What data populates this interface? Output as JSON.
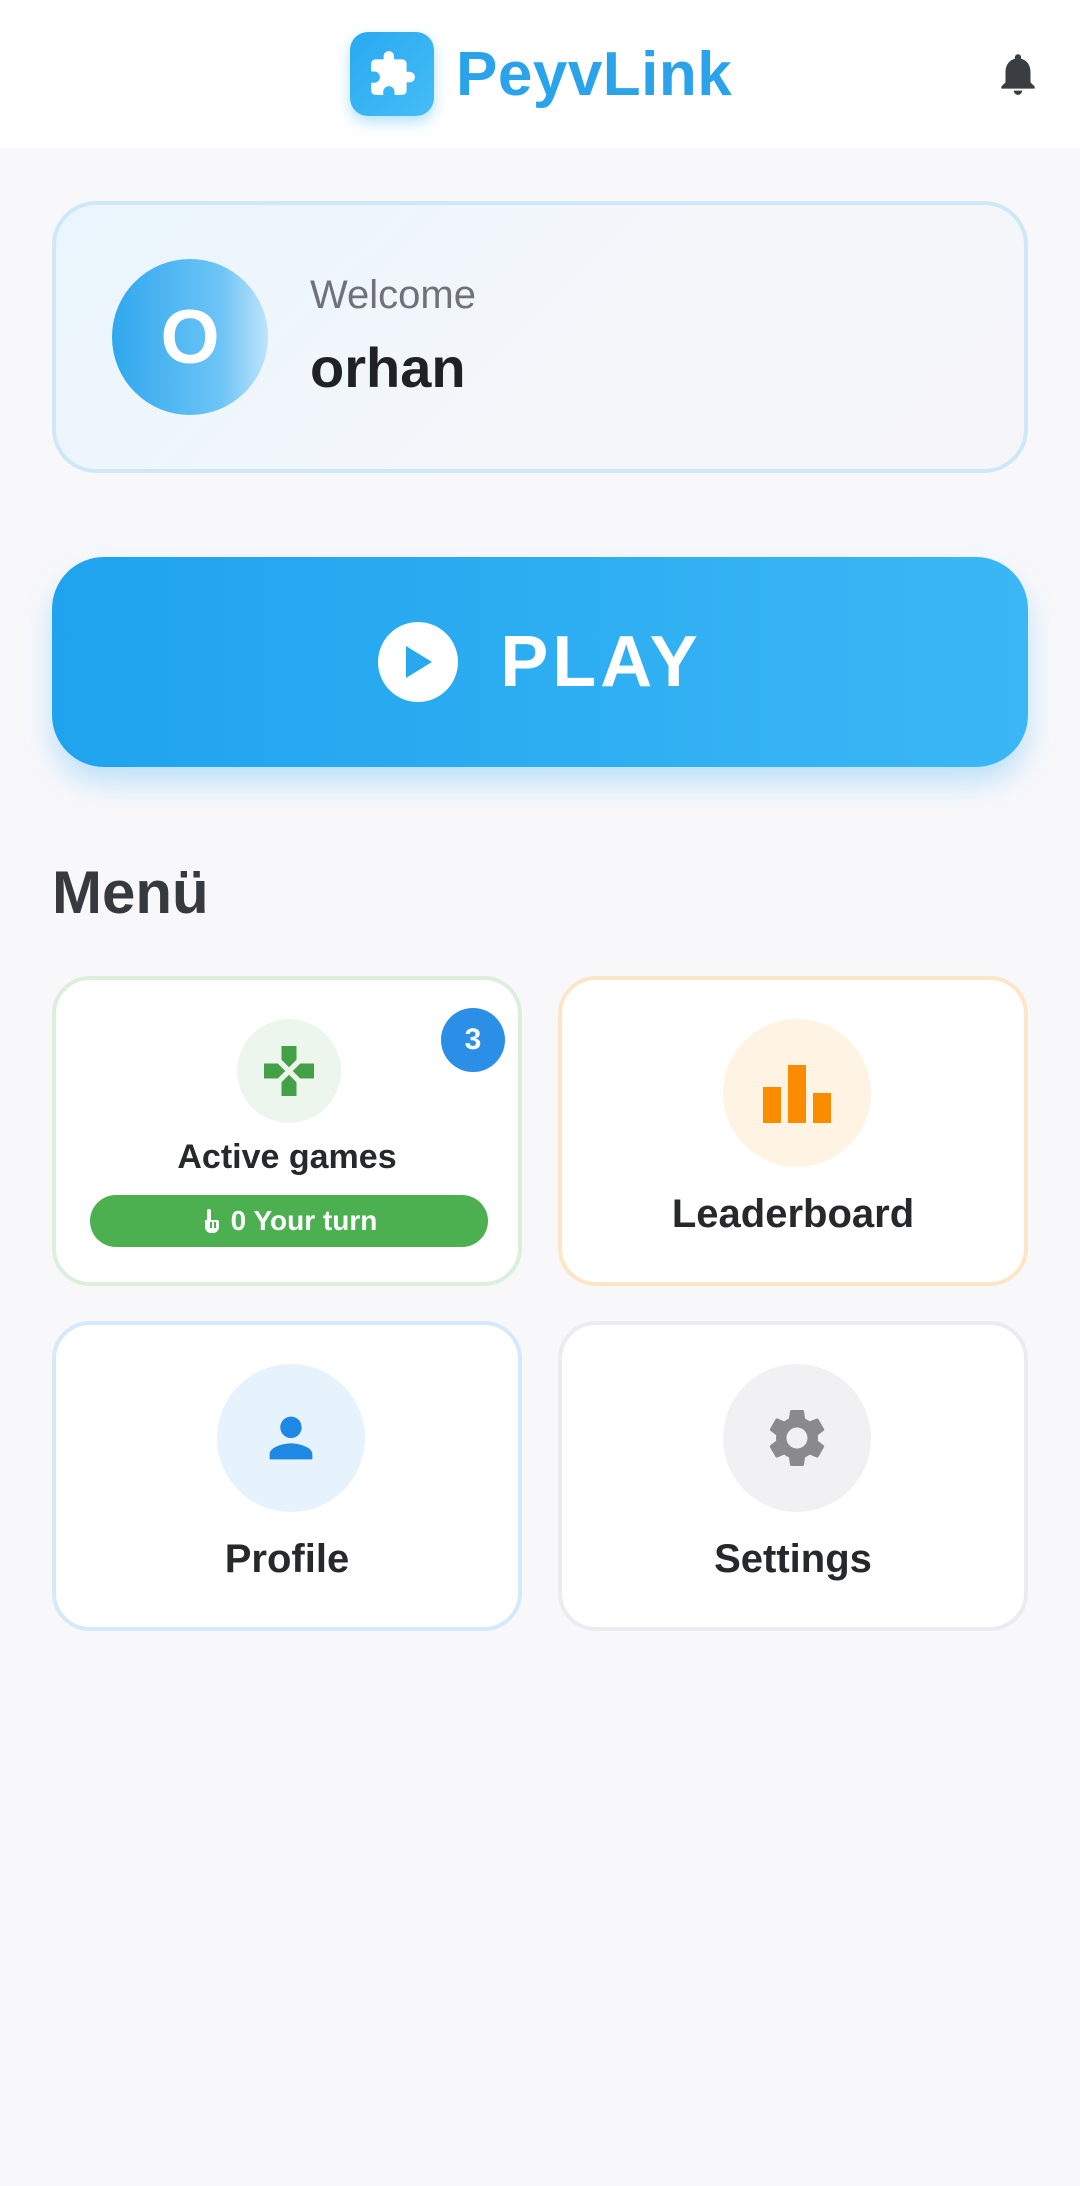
{
  "app": {
    "title": "PeyvLink"
  },
  "header": {
    "logo_icon": "puzzle-icon",
    "notification_icon": "bell-icon"
  },
  "welcome": {
    "label": "Welcome",
    "user_name": "orhan",
    "avatar_initial": "O"
  },
  "play": {
    "label": "PLAY",
    "icon": "play-circle-icon"
  },
  "menu": {
    "title": "Menü",
    "tiles": [
      {
        "id": "active-games",
        "label": "Active games",
        "icon": "gamepad-icon",
        "badge": "3",
        "turn_status": "0 Your turn",
        "turn_icon": "hand-pointer-icon",
        "accent": "#4caf50"
      },
      {
        "id": "leaderboard",
        "label": "Leaderboard",
        "icon": "bar-chart-icon",
        "accent": "#ff9800"
      },
      {
        "id": "profile",
        "label": "Profile",
        "icon": "person-icon",
        "accent": "#2b8fe8"
      },
      {
        "id": "settings",
        "label": "Settings",
        "icon": "gear-icon",
        "accent": "#8a8a8e"
      }
    ]
  },
  "colors": {
    "brand": "#2ba3ea",
    "background": "#f8f8fb"
  }
}
